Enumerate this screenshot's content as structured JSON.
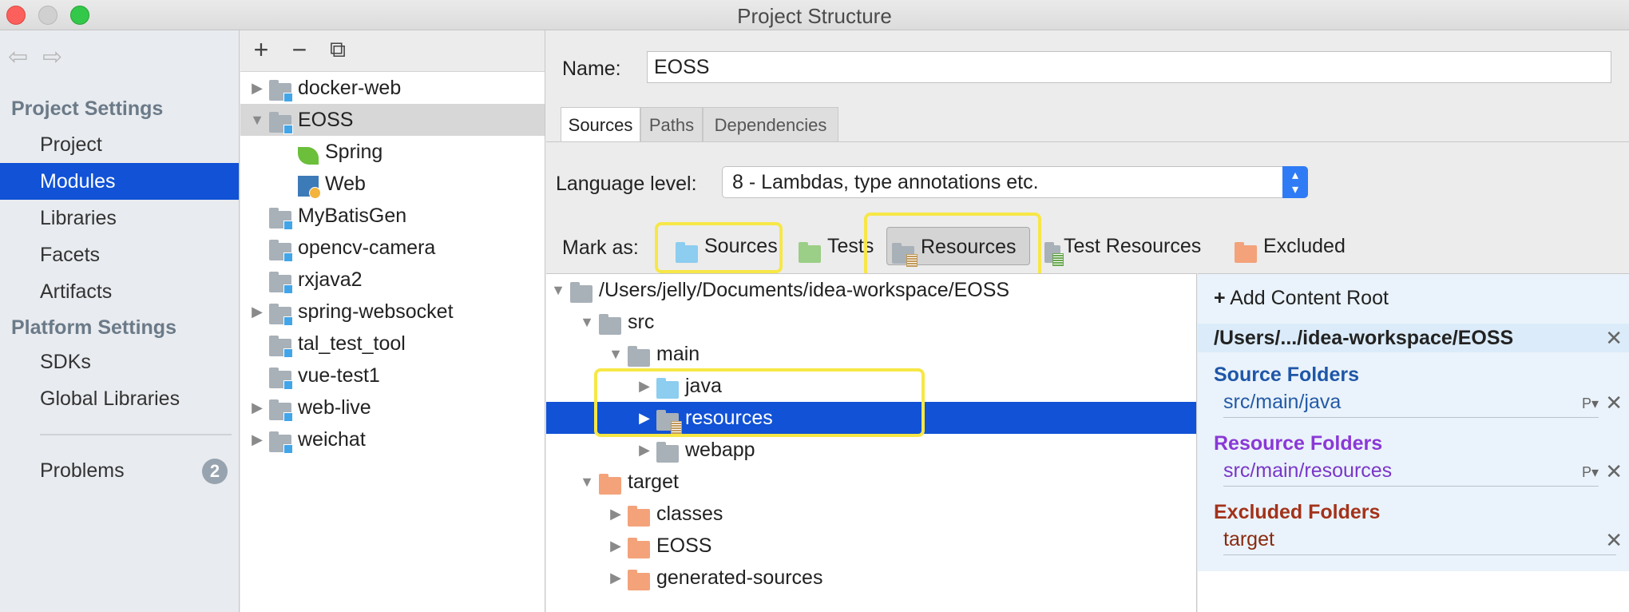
{
  "window": {
    "title": "Project Structure"
  },
  "nav": {
    "project_settings_header": "Project Settings",
    "platform_settings_header": "Platform Settings",
    "items": [
      {
        "label": "Project"
      },
      {
        "label": "Modules",
        "selected": true
      },
      {
        "label": "Libraries"
      },
      {
        "label": "Facets"
      },
      {
        "label": "Artifacts"
      }
    ],
    "platform_items": [
      {
        "label": "SDKs"
      },
      {
        "label": "Global Libraries"
      }
    ],
    "problems": {
      "label": "Problems",
      "count": "2"
    }
  },
  "toolbar": {
    "add": "+",
    "remove": "−",
    "copy": "⧉"
  },
  "modules": [
    {
      "label": "docker-web",
      "expandable": true
    },
    {
      "label": "EOSS",
      "expanded": true,
      "selected": true
    },
    {
      "label": "Spring",
      "facet": "spring"
    },
    {
      "label": "Web",
      "facet": "web"
    },
    {
      "label": "MyBatisGen"
    },
    {
      "label": "opencv-camera"
    },
    {
      "label": "rxjava2"
    },
    {
      "label": "spring-websocket",
      "expandable": true
    },
    {
      "label": "tal_test_tool"
    },
    {
      "label": "vue-test1"
    },
    {
      "label": "web-live",
      "expandable": true
    },
    {
      "label": "weichat",
      "expandable": true
    }
  ],
  "module_detail": {
    "name_label": "Name:",
    "name_value": "EOSS",
    "tabs": [
      "Sources",
      "Paths",
      "Dependencies"
    ],
    "active_tab": "Sources",
    "language_level_label": "Language level:",
    "language_level_value": "8 - Lambdas, type annotations etc.",
    "mark_as_label": "Mark as:",
    "mark_buttons": [
      "Sources",
      "Tests",
      "Resources",
      "Test Resources",
      "Excluded"
    ]
  },
  "content_tree": [
    {
      "label": "/Users/jelly/Documents/idea-workspace/EOSS"
    },
    {
      "label": "src"
    },
    {
      "label": "main"
    },
    {
      "label": "java"
    },
    {
      "label": "resources",
      "selected": true
    },
    {
      "label": "webapp"
    },
    {
      "label": "target"
    },
    {
      "label": "classes"
    },
    {
      "label": "EOSS"
    },
    {
      "label": "generated-sources"
    }
  ],
  "content_root": {
    "add_label": "Add Content Root",
    "path": "/Users/.../idea-workspace/EOSS",
    "source_title": "Source Folders",
    "source_entry": "src/main/java",
    "resource_title": "Resource Folders",
    "resource_entry": "src/main/resources",
    "excluded_title": "Excluded Folders",
    "excluded_entry": "target",
    "prop_mark": "P▾"
  },
  "colors": {
    "selection_blue": "#1152d6",
    "highlight_yellow": "#f7e746",
    "source_title": "#1f56a8",
    "resource_title": "#8a38d6",
    "excluded_title": "#a3321a",
    "source_entry": "#245aa6",
    "resource_entry": "#7a36c8",
    "excluded_entry": "#8a2a10"
  }
}
